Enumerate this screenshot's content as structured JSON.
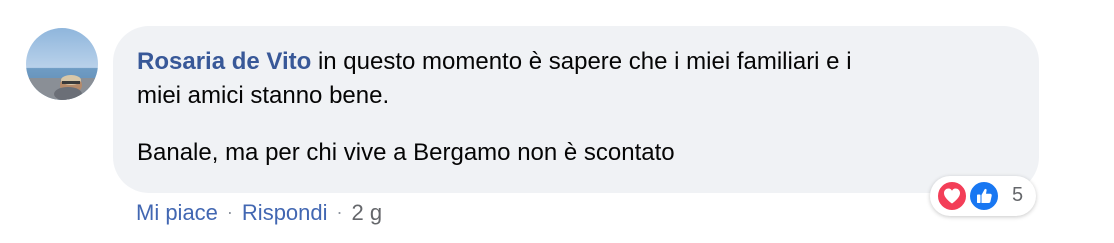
{
  "comment": {
    "author": "Rosaria de Vito",
    "text_line1": "in questo momento è sapere che i miei familiari e i",
    "text_line2": "miei amici stanno bene.",
    "text_paragraph2": "Banale, ma per chi vive a Bergamo non è scontato"
  },
  "reactions": {
    "count": "5",
    "types": [
      "love",
      "like"
    ]
  },
  "actions": {
    "like_label": "Mi piace",
    "reply_label": "Rispondi",
    "separator": "·",
    "timestamp": "2 g"
  },
  "colors": {
    "bubble_bg": "#f0f2f5",
    "author_link": "#385898",
    "action_link": "#4267b2",
    "love": "#f33e58",
    "like": "#1877f2"
  }
}
